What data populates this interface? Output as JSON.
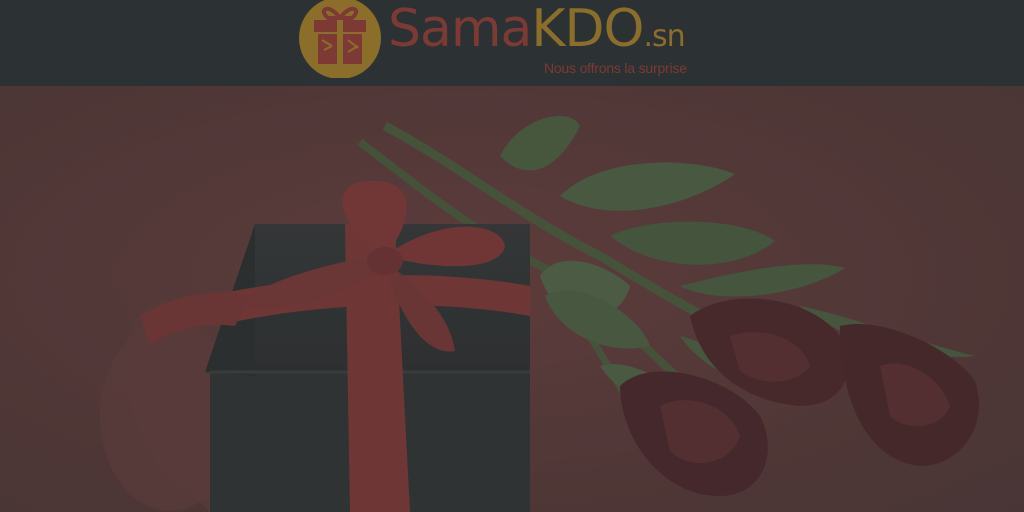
{
  "brand": {
    "name_part1": "Sama",
    "name_part2": "KDO",
    "name_suffix": ".sn",
    "tagline": "Nous offrons la surprise"
  },
  "icons": {
    "logo_icon": "gift-box-icon"
  },
  "colors": {
    "header_bg": "#2c3133",
    "brand_red": "#7d3a34",
    "brand_gold": "#8a6e2a",
    "hero_bg": "#5a3c3c",
    "overlay": "dark"
  }
}
